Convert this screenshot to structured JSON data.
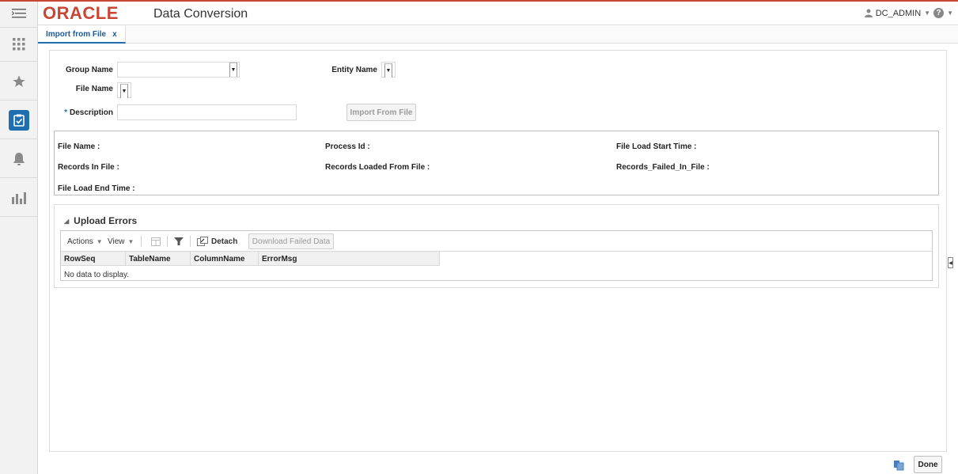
{
  "header": {
    "logo": "ORACLE",
    "app_title": "Data Conversion",
    "user": "DC_ADMIN"
  },
  "tab": {
    "label": "Import from File",
    "close": "x"
  },
  "form": {
    "group_name_label": "Group Name",
    "entity_name_label": "Entity Name",
    "file_name_label": "File Name",
    "description_label": "Description",
    "required_marker": "*",
    "import_button": "Import From File"
  },
  "info": {
    "file_name": "File Name :",
    "process_id": "Process Id :",
    "file_load_start_time": "File Load Start Time :",
    "records_in_file": "Records In File :",
    "records_loaded_from_file": "Records Loaded From File :",
    "records_failed_in_file": "Records_Failed_In_File :",
    "file_load_end_time": "File Load End Time :"
  },
  "upload_errors": {
    "title": "Upload Errors",
    "toolbar": {
      "actions": "Actions",
      "view": "View",
      "detach": "Detach",
      "download_failed": "Download Failed Data"
    },
    "columns": [
      "RowSeq",
      "TableName",
      "ColumnName",
      "ErrorMsg"
    ],
    "empty_text": "No data to display."
  },
  "footer": {
    "done": "Done"
  },
  "colors": {
    "brand": "#c74634",
    "accent": "#1f6fb0"
  },
  "icons": [
    "menu-icon",
    "apps-grid-icon",
    "star-icon",
    "task-icon",
    "bell-icon",
    "reports-icon",
    "user-icon",
    "help-icon",
    "columns-icon",
    "filter-icon",
    "detach-icon",
    "collapse-panel-icon",
    "refresh-icon"
  ]
}
